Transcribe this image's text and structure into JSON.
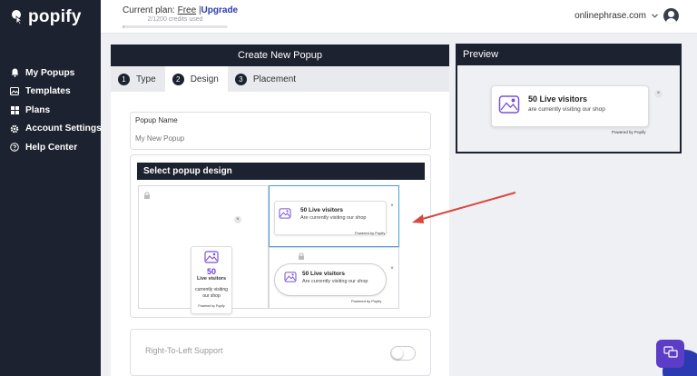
{
  "app": {
    "name": "popify"
  },
  "sidebar": {
    "items": [
      {
        "label": "My Popups",
        "icon": "bell-icon"
      },
      {
        "label": "Templates",
        "icon": "image-icon"
      },
      {
        "label": "Plans",
        "icon": "grid-icon"
      },
      {
        "label": "Account Settings",
        "icon": "gear-icon"
      },
      {
        "label": "Help Center",
        "icon": "help-icon"
      }
    ]
  },
  "topbar": {
    "plan_prefix": "Current plan:",
    "plan_name": "Free",
    "separator": "|",
    "upgrade_label": "Upgrade",
    "credits_text": "2/1200 credits used",
    "credits_fraction": 0.0017,
    "account_name": "onlinephrase.com"
  },
  "panel": {
    "title": "Create New Popup",
    "tabs": [
      {
        "num": "1",
        "label": "Type"
      },
      {
        "num": "2",
        "label": "Design"
      },
      {
        "num": "3",
        "label": "Placement"
      }
    ],
    "popup_name_label": "Popup Name",
    "popup_name_placeholder": "My New Popup",
    "design_heading": "Select popup design",
    "rtl_label": "Right-To-Left Support",
    "rtl_enabled": false
  },
  "designs": {
    "vertical": {
      "count": "50",
      "title": "Live visitors",
      "sub": "currently visiting our shop",
      "powered": "Powered by Popify"
    },
    "horizontal": {
      "title": "50 Live visitors",
      "sub": "Are currently visiting our shop",
      "powered": "Powered by Popify"
    },
    "rounded": {
      "title": "50 Live visitors",
      "sub": "Are currently visiting our shop",
      "powered": "Powered by Popify"
    }
  },
  "preview": {
    "title": "Preview",
    "card_title": "50 Live visitors",
    "card_sub": "are currently visiting our shop",
    "powered": "Powered by Popify"
  },
  "colors": {
    "dark": "#1d2230",
    "accent": "#2b3ab0",
    "purple": "#5b3dc7",
    "arrow": "#d9473e"
  }
}
